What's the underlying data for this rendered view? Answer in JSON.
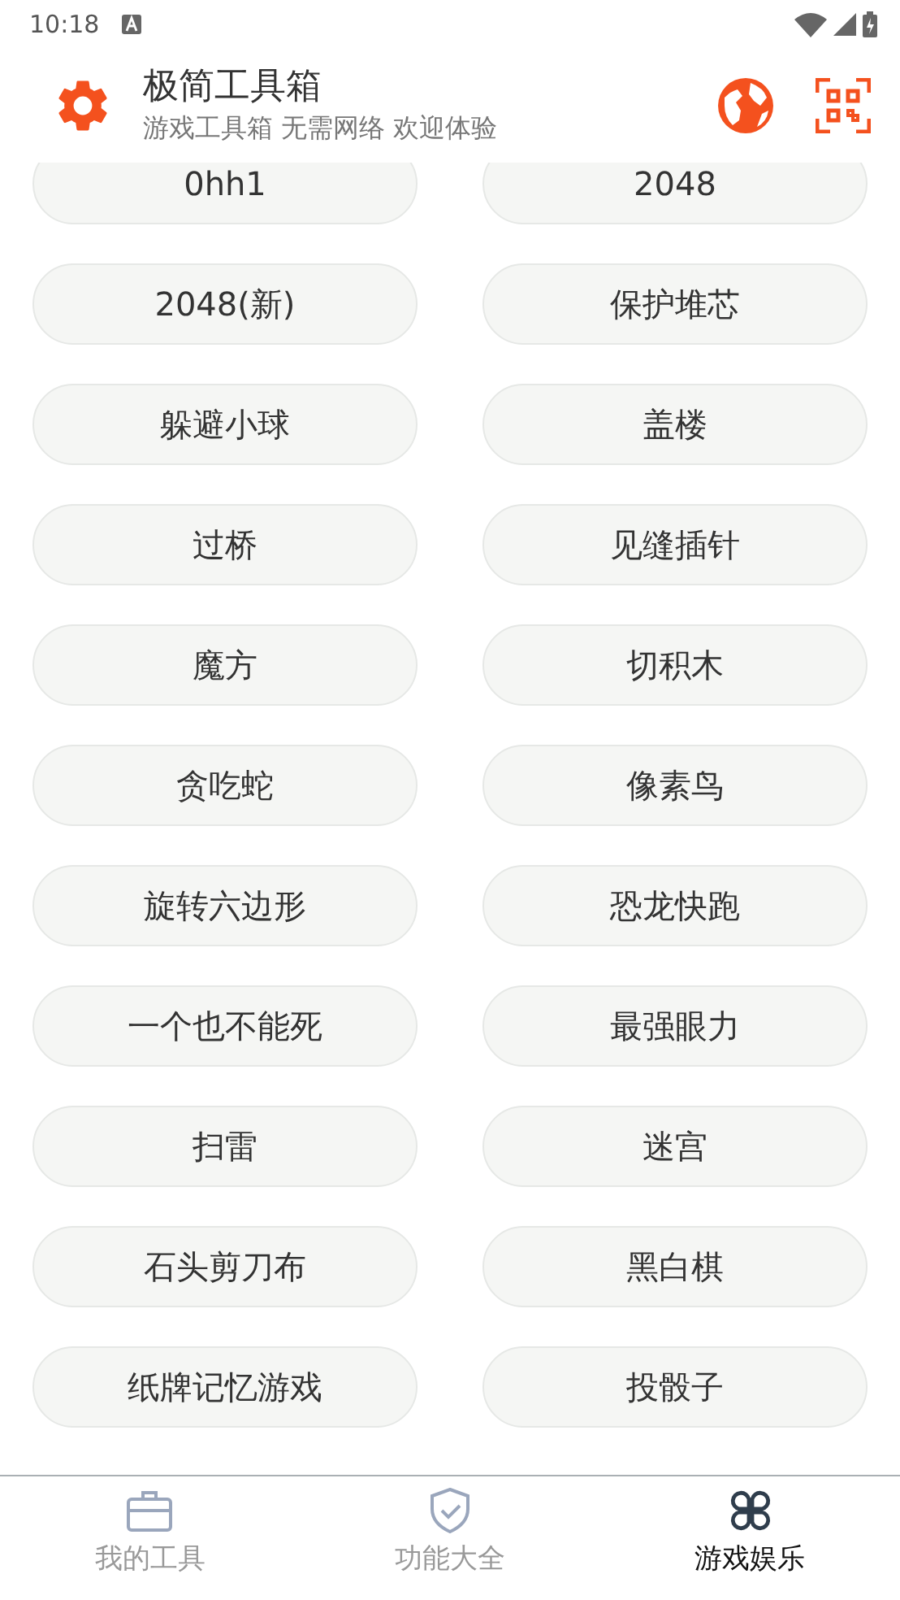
{
  "status_bar": {
    "time": "10:18"
  },
  "header": {
    "title": "极简工具箱",
    "subtitle": "游戏工具箱 无需网络 欢迎体验"
  },
  "games": [
    {
      "label": "0hh1"
    },
    {
      "label": "2048"
    },
    {
      "label": "2048(新)"
    },
    {
      "label": "保护堆芯"
    },
    {
      "label": "躲避小球"
    },
    {
      "label": "盖楼"
    },
    {
      "label": "过桥"
    },
    {
      "label": "见缝插针"
    },
    {
      "label": "魔方"
    },
    {
      "label": "切积木"
    },
    {
      "label": "贪吃蛇"
    },
    {
      "label": "像素鸟"
    },
    {
      "label": "旋转六边形"
    },
    {
      "label": "恐龙快跑"
    },
    {
      "label": "一个也不能死"
    },
    {
      "label": "最强眼力"
    },
    {
      "label": "扫雷"
    },
    {
      "label": "迷宫"
    },
    {
      "label": "石头剪刀布"
    },
    {
      "label": "黑白棋"
    },
    {
      "label": "纸牌记忆游戏"
    },
    {
      "label": "投骰子"
    }
  ],
  "bottom_nav": [
    {
      "label": "我的工具",
      "selected": false
    },
    {
      "label": "功能大全",
      "selected": false
    },
    {
      "label": "游戏娱乐",
      "selected": true
    }
  ]
}
